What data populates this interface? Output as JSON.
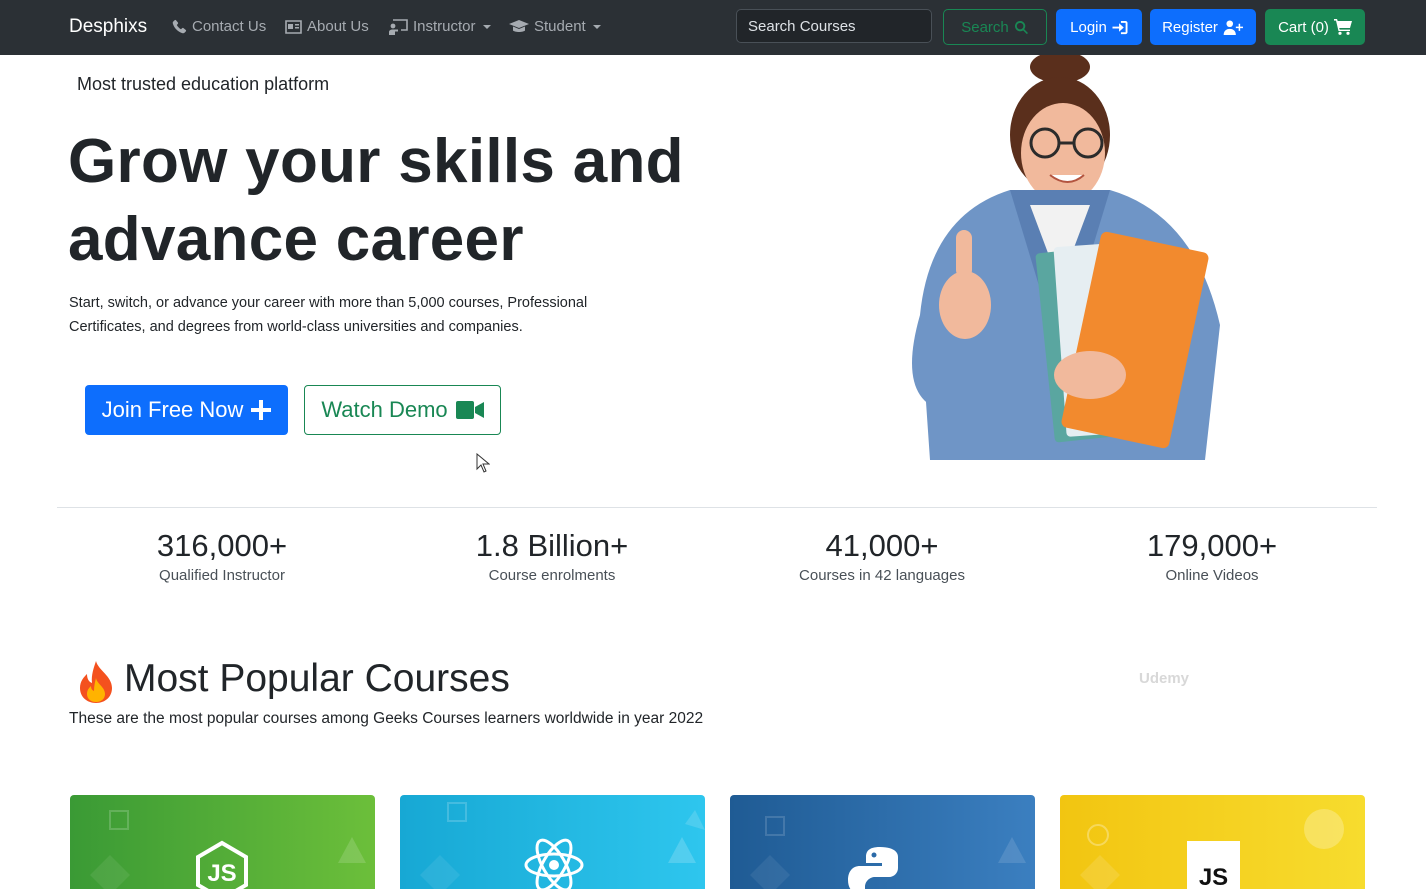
{
  "nav": {
    "brand": "Desphixs",
    "links": [
      {
        "label": "Contact Us",
        "icon": "phone-icon"
      },
      {
        "label": "About Us",
        "icon": "id-card-icon"
      },
      {
        "label": "Instructor",
        "icon": "chalkboard-teacher-icon",
        "dropdown": true
      },
      {
        "label": "Student",
        "icon": "graduation-cap-icon",
        "dropdown": true
      }
    ],
    "search_placeholder": "Search Courses",
    "search_label": "Search",
    "login_label": "Login",
    "register_label": "Register",
    "cart_label": "Cart (0)"
  },
  "hero": {
    "tagline": "Most trusted education platform",
    "title_line1": "Grow your skills and",
    "title_line2": "advance career",
    "subtitle_line1": "Start, switch, or advance your career with more than 5,000 courses, Professional",
    "subtitle_line2": "Certificates, and degrees from world-class universities and companies.",
    "join_label": "Join Free Now",
    "demo_label": "Watch Demo"
  },
  "stats": [
    {
      "value": "316,000+",
      "label": "Qualified Instructor"
    },
    {
      "value": "1.8 Billion+",
      "label": "Course enrolments"
    },
    {
      "value": "41,000+",
      "label": "Courses in 42 languages"
    },
    {
      "value": "179,000+",
      "label": "Online Videos"
    }
  ],
  "courses": {
    "title": "Most Popular Courses",
    "subtitle": "These are the most popular courses among Geeks Courses learners worldwide in year 2022",
    "watermark": "Udemy",
    "cards": [
      {
        "icon": "nodejs-icon",
        "color": "#3f9c35"
      },
      {
        "icon": "react-icon",
        "color": "#1fb5e3"
      },
      {
        "icon": "python-icon",
        "color": "#2b6aa8"
      },
      {
        "icon": "javascript-icon",
        "color": "#f5d31c",
        "badge": "JS"
      }
    ]
  },
  "colors": {
    "navbar": "#2b3035",
    "primary": "#0d6efd",
    "success": "#198754"
  }
}
